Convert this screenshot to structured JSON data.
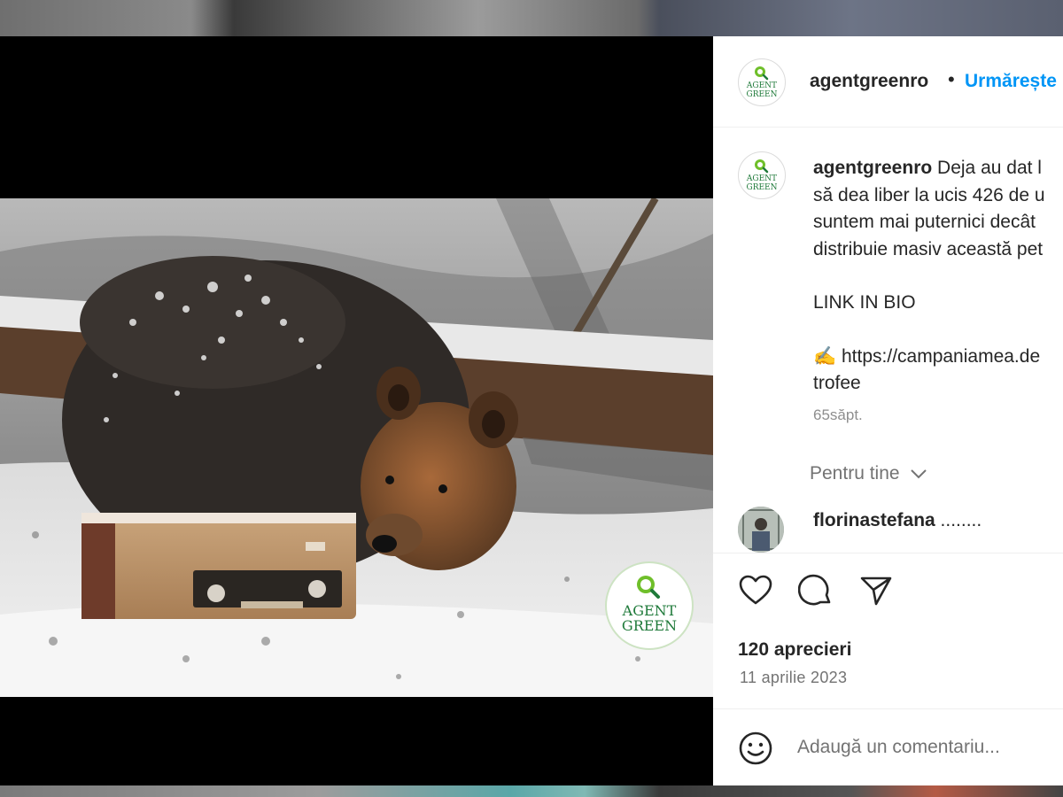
{
  "post": {
    "account": "agentgreenro",
    "follow_label": "Urmărește",
    "logo_text": [
      "AGENT",
      "GREEN"
    ],
    "caption_lines": [
      "Deja au dat l",
      "să dea liber la ucis 426 de u",
      "suntem mai puternici decât",
      "distribuie masiv această pet"
    ],
    "caption_link_label": "LINK IN BIO",
    "caption_url_line": "https://campaniamea.de",
    "caption_url_line2": "trofee",
    "caption_emoji": "✍️",
    "time_ago": "65săpt.",
    "for_you_label": "Pentru tine",
    "likes": "120 aprecieri",
    "date": "11 aprilie 2023",
    "comment_placeholder": "Adaugă un comentariu..."
  },
  "comments": [
    {
      "user": "florinastefana",
      "text": "........"
    }
  ],
  "icons": {
    "like": "heart-icon",
    "comment": "comment-icon",
    "share": "send-icon",
    "emoji": "smiley-icon",
    "dropdown": "chevron-down-icon"
  },
  "colors": {
    "follow_blue": "#0095f6",
    "brand_green": "#6fbf2a",
    "brand_dark_green": "#1f7a3a"
  }
}
